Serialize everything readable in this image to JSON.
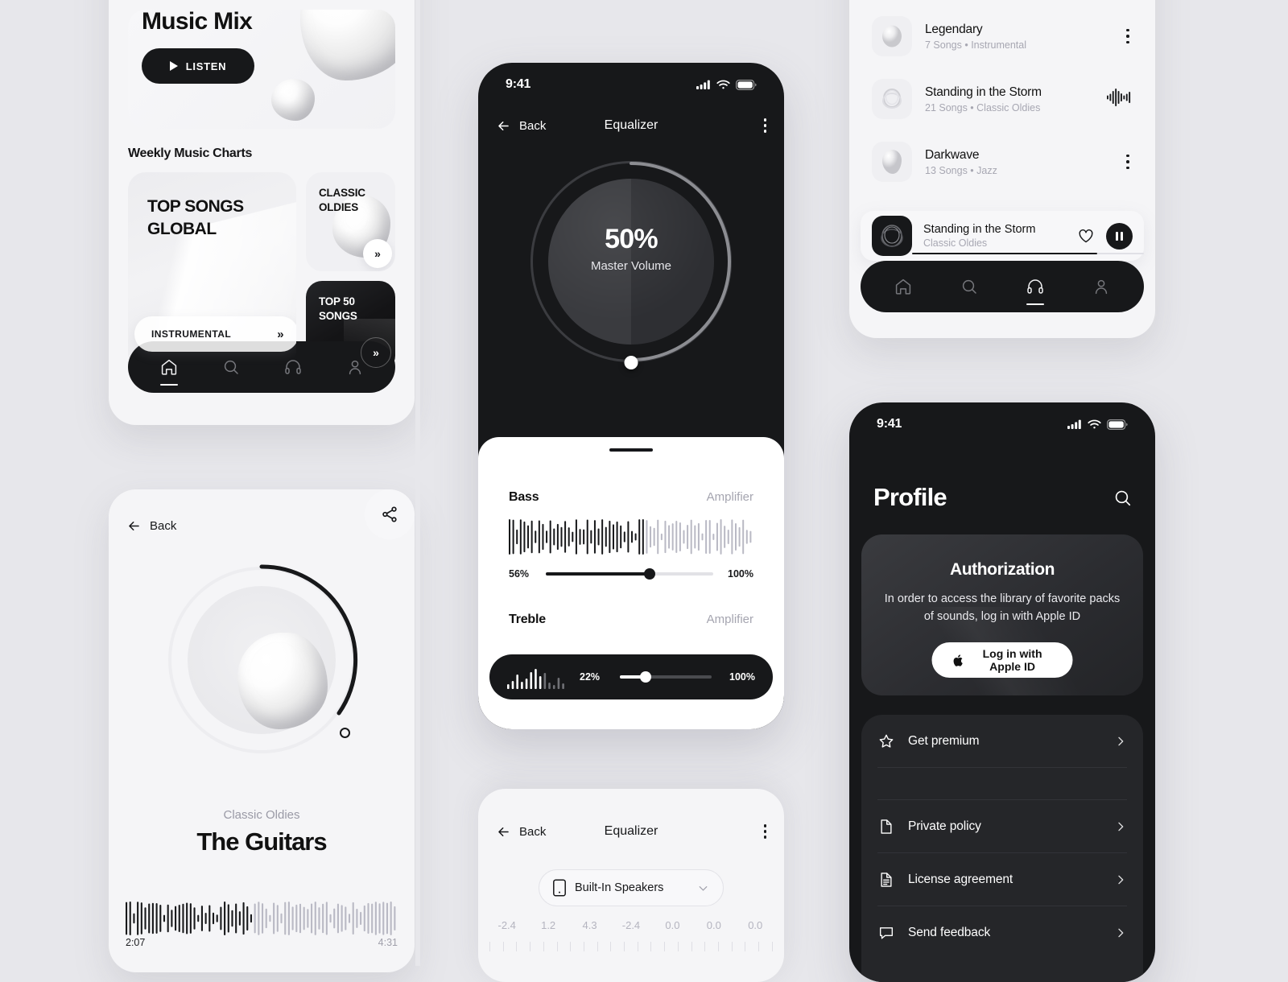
{
  "home": {
    "hero_title": "Music Mix",
    "listen_label": "LISTEN",
    "section_label": "Weekly Music Charts",
    "top_songs_title": "TOP SONGS GLOBAL",
    "instrumental_label": "INSTRUMENTAL",
    "classic_oldies_title": "CLASSIC OLDIES",
    "top50_title": "TOP 50 SONGS",
    "chevron": "»",
    "nav": [
      {
        "name": "home",
        "active": true
      },
      {
        "name": "search",
        "active": false
      },
      {
        "name": "headphones",
        "active": false
      },
      {
        "name": "profile",
        "active": false
      }
    ]
  },
  "player": {
    "back_label": "Back",
    "subtitle": "Classic Oldies",
    "title": "The Guitars",
    "time_current": "2:07",
    "time_total": "4:31",
    "progress_percent": 46
  },
  "equalizer_phone": {
    "status_time": "9:41",
    "back_label": "Back",
    "title": "Equalizer",
    "volume_percent": "50%",
    "volume_label": "Master Volume",
    "bands": [
      {
        "name": "Bass",
        "mode": "Amplifier",
        "min_label": "56%",
        "max_label": "100%",
        "value": 56
      },
      {
        "name": "Treble",
        "mode": "Amplifier",
        "min_label": "22%",
        "max_label": "100%",
        "value": 22
      }
    ]
  },
  "equalizer_card": {
    "back_label": "Back",
    "title": "Equalizer",
    "output_device": "Built-In Speakers",
    "eq_values": [
      "-2.4",
      "1.2",
      "4.3",
      "-2.4",
      "0.0",
      "0.0",
      "0.0"
    ]
  },
  "playlists": {
    "items": [
      {
        "title": "Legendary",
        "subtitle": "7 Songs • Instrumental",
        "trailing": "kebab"
      },
      {
        "title": "Standing in the Storm",
        "subtitle": "21 Songs • Classic Oldies",
        "trailing": "equalizer"
      },
      {
        "title": "Darkwave",
        "subtitle": "13 Songs • Jazz",
        "trailing": "kebab"
      }
    ],
    "now_playing": {
      "title": "Standing in the Storm",
      "subtitle": "Classic Oldies",
      "progress_percent": 80
    },
    "nav": [
      {
        "name": "home",
        "active": false
      },
      {
        "name": "search",
        "active": false
      },
      {
        "name": "headphones",
        "active": true
      },
      {
        "name": "profile",
        "active": false
      }
    ]
  },
  "profile": {
    "status_time": "9:41",
    "title": "Profile",
    "auth_heading": "Authorization",
    "auth_text": "In order to access the library of favorite packs of sounds, log in with Apple ID",
    "apple_button": "Log in with Apple ID",
    "menu": [
      {
        "label": "Get premium",
        "icon": "star-icon"
      },
      {
        "label": "Private policy",
        "icon": "document-icon"
      },
      {
        "label": "License agreement",
        "icon": "license-icon"
      },
      {
        "label": "Send feedback",
        "icon": "chat-icon"
      }
    ]
  },
  "colors": {
    "background": "#e7e7eb",
    "surface": "#f5f5f7",
    "ink": "#17181a",
    "muted": "#a7a7b2"
  }
}
